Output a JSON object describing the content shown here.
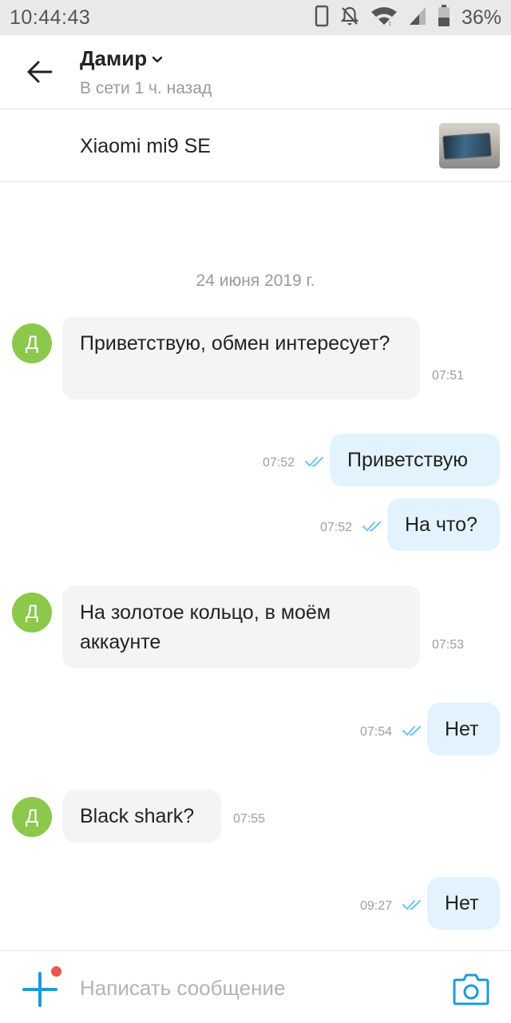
{
  "status_bar": {
    "time": "10:44:43",
    "battery": "36%",
    "icons": [
      "vibrate-icon",
      "notifications-off-icon",
      "wifi-icon",
      "signal-icon",
      "battery-icon"
    ]
  },
  "header": {
    "name": "Дамир",
    "status": "В сети 1 ч. назад"
  },
  "listing": {
    "title": "Xiaomi mi9 SE"
  },
  "conversation": {
    "date": "24 июня 2019 г.",
    "avatar_letter": "Д",
    "messages": [
      {
        "direction": "in",
        "text": "Приветствую,  обмен интересует?",
        "time": "07:51"
      },
      {
        "direction": "out",
        "text": "Приветствую",
        "time": "07:52",
        "read": true
      },
      {
        "direction": "out",
        "text": "На что?",
        "time": "07:52",
        "read": true
      },
      {
        "direction": "in",
        "text": "На золотое кольцо,  в моём аккаунте",
        "time": "07:53"
      },
      {
        "direction": "out",
        "text": "Нет",
        "time": "07:54",
        "read": true
      },
      {
        "direction": "in",
        "text": "Black shark?",
        "time": "07:55"
      },
      {
        "direction": "out",
        "text": "Нет",
        "time": "09:27",
        "read": true
      }
    ]
  },
  "composer": {
    "placeholder": "Написать сообщение",
    "value": ""
  },
  "colors": {
    "accent": "#1a9bd7",
    "avatar": "#8cc84b",
    "incoming_bubble": "#f4f4f4",
    "outgoing_bubble": "#e2f3fd",
    "read_ticks": "#6fc3ee",
    "notification_dot": "#ef5350"
  }
}
